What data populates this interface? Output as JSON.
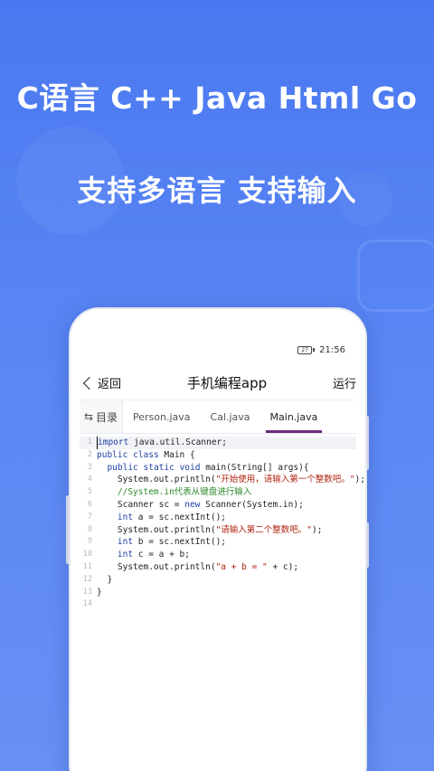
{
  "headline": {
    "line1": "C语言 C++ Java Html Go",
    "line2": "支持多语言 支持输入"
  },
  "status": {
    "battery": "27",
    "time": "21:56"
  },
  "appbar": {
    "back_label": "返回",
    "title": "手机编程app",
    "run_label": "运行"
  },
  "tabs": {
    "dir_label": "目录",
    "items": [
      {
        "label": "Person.java",
        "active": false
      },
      {
        "label": "Cal.java",
        "active": false
      },
      {
        "label": "Main.java",
        "active": true
      }
    ]
  },
  "code_lines": [
    [
      {
        "t": "import",
        "c": "kw"
      },
      {
        "t": " java.util.Scanner;",
        "c": ""
      }
    ],
    [
      {
        "t": "public",
        "c": "kw"
      },
      {
        "t": " ",
        "c": ""
      },
      {
        "t": "class",
        "c": "kw"
      },
      {
        "t": " Main {",
        "c": ""
      }
    ],
    [
      {
        "t": "  ",
        "c": ""
      },
      {
        "t": "public",
        "c": "kw"
      },
      {
        "t": " ",
        "c": ""
      },
      {
        "t": "static",
        "c": "kw"
      },
      {
        "t": " ",
        "c": ""
      },
      {
        "t": "void",
        "c": "kw"
      },
      {
        "t": " main(String[] args){",
        "c": ""
      }
    ],
    [
      {
        "t": "    System.out.println(",
        "c": ""
      },
      {
        "t": "\"开始使用，请输入第一个整数吧。\"",
        "c": "str"
      },
      {
        "t": ");",
        "c": ""
      }
    ],
    [
      {
        "t": "    ",
        "c": ""
      },
      {
        "t": "//System.in代表从键盘进行输入",
        "c": "cmt"
      }
    ],
    [
      {
        "t": "    Scanner sc = ",
        "c": ""
      },
      {
        "t": "new",
        "c": "kw"
      },
      {
        "t": " Scanner(System.in);",
        "c": ""
      }
    ],
    [
      {
        "t": "    ",
        "c": ""
      },
      {
        "t": "int",
        "c": "kw"
      },
      {
        "t": " a = sc.nextInt();",
        "c": ""
      }
    ],
    [
      {
        "t": "    System.out.println(",
        "c": ""
      },
      {
        "t": "\"请输入第二个整数吧。\"",
        "c": "str"
      },
      {
        "t": ");",
        "c": ""
      }
    ],
    [
      {
        "t": "    ",
        "c": ""
      },
      {
        "t": "int",
        "c": "kw"
      },
      {
        "t": " b = sc.nextInt();",
        "c": ""
      }
    ],
    [
      {
        "t": "    ",
        "c": ""
      },
      {
        "t": "int",
        "c": "kw"
      },
      {
        "t": " c = a + b;",
        "c": ""
      }
    ],
    [
      {
        "t": "    System.out.println(",
        "c": ""
      },
      {
        "t": "\"a + b = \"",
        "c": "str"
      },
      {
        "t": " + c);",
        "c": ""
      }
    ],
    [
      {
        "t": "  }",
        "c": ""
      }
    ],
    [
      {
        "t": "}",
        "c": ""
      }
    ],
    []
  ],
  "colors": {
    "background": "#5a86f4",
    "keyword": "#1d3fa3",
    "string": "#b0210f",
    "comment": "#2c8a2c",
    "tab_indicator": "#6b2a7a"
  }
}
